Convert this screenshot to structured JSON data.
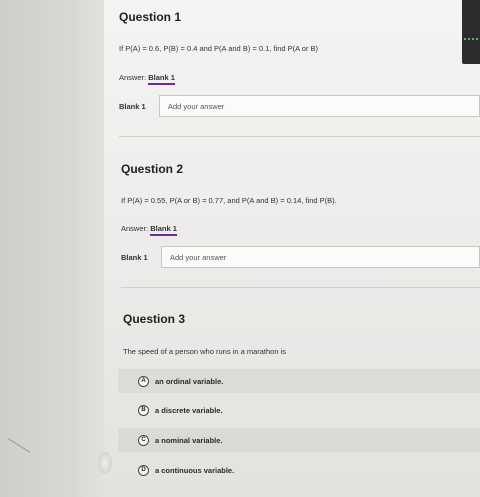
{
  "q1": {
    "title": "Question 1",
    "text": "If P(A) = 0.6, P(B) = 0.4 and P(A and B) = 0.1, find P(A or B)",
    "answer_prefix": "Answer:",
    "answer_blank": "Blank 1",
    "blank_label": "Blank 1",
    "placeholder": "Add your answer"
  },
  "q2": {
    "title": "Question 2",
    "text": "If P(A) = 0.55, P(A or B) = 0.77, and P(A and B) = 0.14, find P(B).",
    "answer_prefix": "Answer:",
    "answer_blank": "Blank 1",
    "blank_label": "Blank 1",
    "placeholder": "Add your answer"
  },
  "q3": {
    "title": "Question 3",
    "text": "The speed of a person who runs in a marathon is",
    "options": [
      {
        "letter": "A",
        "text": "an ordinal variable."
      },
      {
        "letter": "B",
        "text": "a discrete variable."
      },
      {
        "letter": "C",
        "text": "a nominal variable."
      },
      {
        "letter": "D",
        "text": "a continuous variable."
      }
    ]
  }
}
